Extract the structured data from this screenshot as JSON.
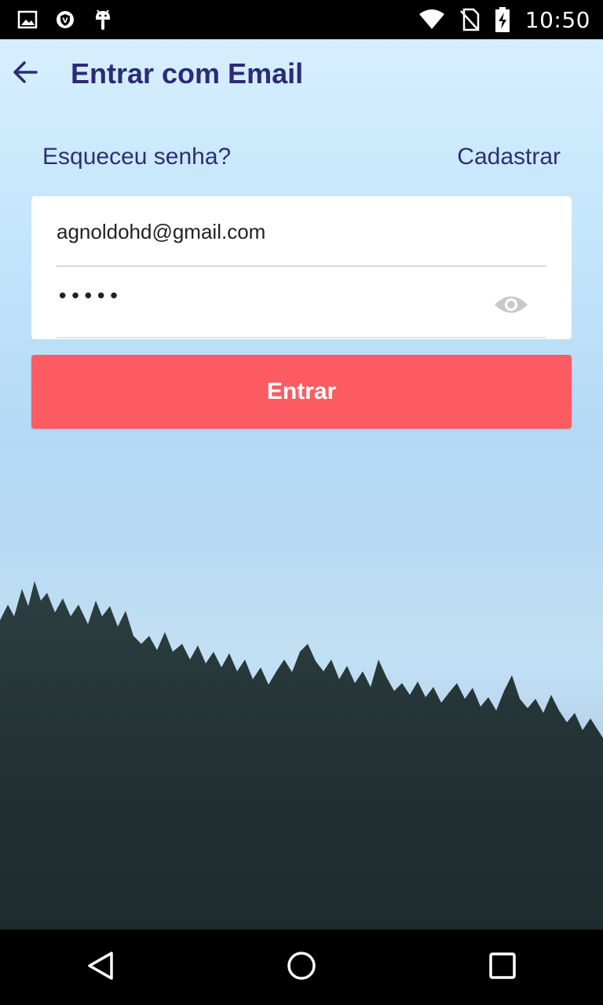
{
  "status_bar": {
    "time": "10:50",
    "left_icons": [
      "image-icon",
      "shield-icon",
      "android-icon"
    ],
    "right_icons": [
      "wifi-icon",
      "no-sim-icon",
      "battery-charging-icon"
    ]
  },
  "app_bar": {
    "title": "Entrar com Email",
    "back_icon": "arrow-back-icon",
    "title_color": "#2c2a78"
  },
  "links": {
    "forgot_password": "Esqueceu senha?",
    "register": "Cadastrar"
  },
  "form": {
    "email_value": "agnoldohd@gmail.com",
    "password_value": "•••••",
    "toggle_visibility_icon": "eye-icon"
  },
  "primary_button": {
    "label": "Entrar",
    "color": "#fd5b62"
  },
  "nav_bar": {
    "back": "nav-back-icon",
    "home": "nav-home-icon",
    "recents": "nav-recents-icon"
  }
}
